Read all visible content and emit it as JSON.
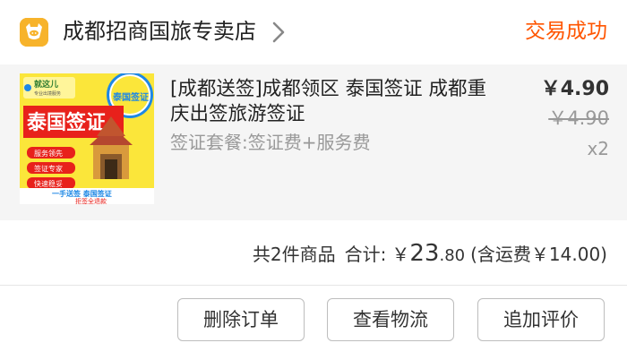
{
  "store": {
    "name": "成都招商国旅专卖店",
    "icon": "store-logo-icon",
    "chevron_icon": "chevron-right-icon"
  },
  "order": {
    "status": "交易成功"
  },
  "product": {
    "title": "[成都送签]成都领区 泰国签证 成都重庆出签旅游签证",
    "sku": "签证套餐:签证费+服务费",
    "price_current": "￥4.90",
    "price_original": "￥4.90",
    "quantity": "x2",
    "thumbnail": {
      "brand": "就这儿",
      "brand_sub": "专业出境服务",
      "badge": "泰国签证",
      "headline": "泰国签证",
      "bullets": [
        "服务领先",
        "签证专家",
        "快速稳妥"
      ],
      "footer1": "一手送签 泰国签证",
      "footer2": "拒签全退款"
    }
  },
  "summary": {
    "items_count": "共2件商品",
    "total_label": "合计:",
    "currency": "￥",
    "total_integer": "23",
    "total_decimal": ".80",
    "shipping": "(含运费￥14.00)"
  },
  "actions": {
    "delete_label": "删除订单",
    "logistics_label": "查看物流",
    "review_label": "追加评价"
  },
  "colors": {
    "status": "#ff5500",
    "product_bg": "#f5f5f5",
    "thumb_bg": "#fbe63a",
    "thumb_red": "#e8211b",
    "thumb_blue": "#1e88e5"
  }
}
